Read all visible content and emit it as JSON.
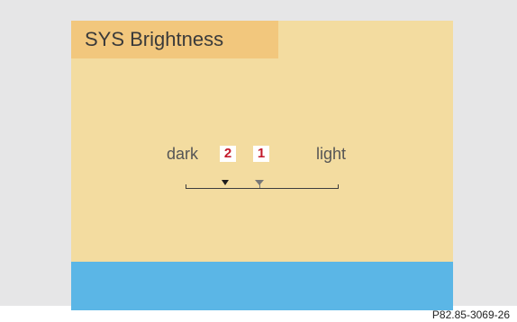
{
  "screen": {
    "title": "SYS Brightness",
    "labels": {
      "dark": "dark",
      "light": "light"
    },
    "markers": [
      {
        "number": "2"
      },
      {
        "number": "1"
      }
    ],
    "slider": {
      "current_level": 0.26,
      "previous_level": 0.48
    },
    "colors": {
      "screen_background": "#f3dca0",
      "title_highlight": "#f2c77d",
      "bottom_band": "#5bb6e6",
      "marker_number": "#c3192a"
    }
  },
  "figure": {
    "reference_code": "P82.85-3069-26"
  }
}
